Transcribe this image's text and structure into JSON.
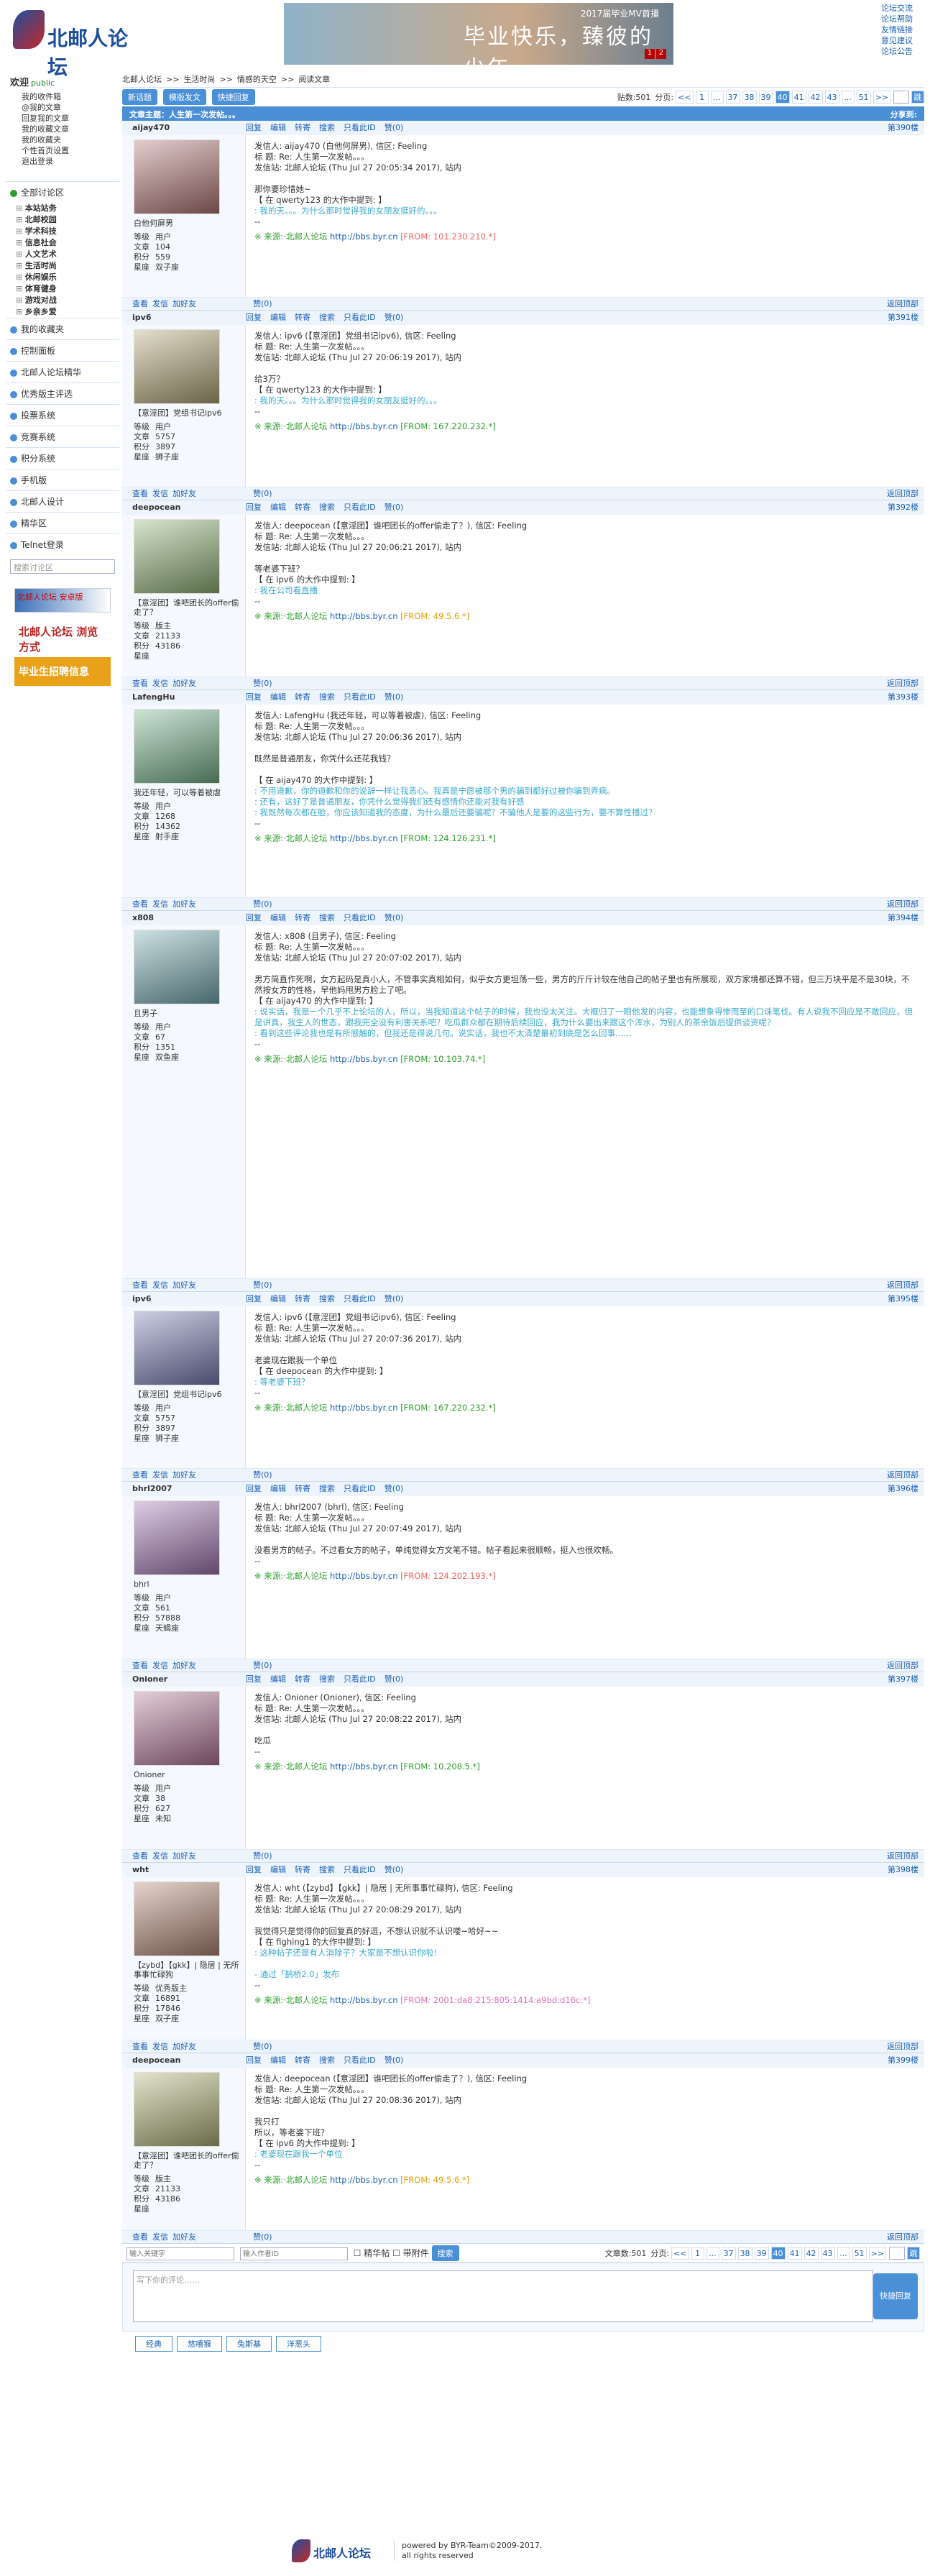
{
  "site": {
    "logo": "北邮人论坛",
    "banner_title": "毕业快乐，臻彼的少年",
    "banner_sub": "2017届毕业MV首播",
    "banner_pages": [
      "1",
      "2"
    ]
  },
  "toplinks": [
    "论坛交流",
    "论坛帮助",
    "友情链接",
    "意见建议",
    "论坛公告"
  ],
  "sidebar": {
    "welcome": "欢迎",
    "user": "public",
    "user_items": [
      "我的收件箱",
      "@我的文章",
      "回复我的文章",
      "我的收藏文章",
      "我的收藏夹",
      "个性首页设置",
      "退出登录"
    ],
    "sections": [
      "全部讨论区",
      "北邮人论坛精华",
      "优秀版主评选",
      "投票系统",
      "竞赛系统",
      "积分系统",
      "手机版",
      "北邮人设计",
      "精华区",
      "Telnet登录"
    ],
    "categories": [
      "本站站务",
      "北邮校园",
      "学术科技",
      "信息社会",
      "人文艺术",
      "生活时尚",
      "休闲娱乐",
      "体育健身",
      "游戏对战",
      "乡亲乡爱"
    ],
    "extra": [
      "我的收藏夹",
      "控制面板"
    ],
    "search_placeholder": "搜索讨论区",
    "ad1": "北邮人论坛 安卓版",
    "ad2": "北邮人论坛 浏览方式",
    "ad3": "毕业生招聘信息"
  },
  "crumb": [
    "北邮人论坛",
    ">>",
    "生活时尚",
    ">>",
    "情感的天空",
    ">>",
    "阅读文章"
  ],
  "toolbar": {
    "new": "新话题",
    "mode": "模版发文",
    "quick": "快捷回复",
    "count_label": "贴数:501",
    "page_label": "分页:"
  },
  "pager": [
    "<<",
    "1",
    "...",
    "37",
    "38",
    "39",
    "40",
    "41",
    "42",
    "43",
    "...",
    "51",
    ">>"
  ],
  "pager_current": "40",
  "thread_title": "文章主题：人生第一次发帖。。。",
  "share": "分享到:",
  "actions": [
    "回复",
    "编辑",
    "转寄",
    "搜索",
    "只看此ID",
    "赞(0)"
  ],
  "foot_actions": [
    "查看",
    "发信",
    "加好友"
  ],
  "back_top": "返回顶部",
  "label_level": "等级",
  "label_posts": "文章",
  "label_score": "积分",
  "label_star": "星座",
  "posts": [
    {
      "user": "aijay470",
      "floor": "第390楼",
      "nick": "白他何屏男",
      "level": "用户",
      "posts": "104",
      "score": "559",
      "star": "双子座",
      "lines": [
        "发信人: aijay470 (白他何屏男), 信区: Feeling",
        "标 题: Re: 人生第一次发帖。。。",
        "发信站: 北邮人论坛 (Thu Jul 27 20:05:34 2017), 站内",
        "",
        "那你要珍惜她~",
        "【 在 qwerty123 的大作中提到: 】"
      ],
      "quotes": [
        ": 我的天。。。为什么那时觉得我的女朋友挺好的。。。"
      ],
      "ip": "[FROM: 101.230.210.*]",
      "ipc": "#f06060"
    },
    {
      "user": "ipv6",
      "floor": "第391楼",
      "nick": "【意淫团】党组书记ipv6",
      "level": "用户",
      "posts": "5757",
      "score": "3897",
      "star": "狮子座",
      "lines": [
        "发信人: ipv6 (【意淫团】党组书记ipv6), 信区: Feeling",
        "标 题: Re: 人生第一次发帖。。。",
        "发信站: 北邮人论坛 (Thu Jul 27 20:06:19 2017), 站内",
        "",
        "给3万？",
        "【 在 qwerty123 的大作中提到: 】"
      ],
      "quotes": [
        ": 我的天。。。为什么那时觉得我的女朋友挺好的。。。"
      ],
      "ip": "[FROM: 167.220.232.*]",
      "ipc": "#2e9e2e"
    },
    {
      "user": "deepocean",
      "floor": "第392楼",
      "nick": "【意淫团】谁吧团长的offer偷走了？",
      "level": "版主",
      "posts": "21133",
      "score": "43186",
      "star": "",
      "lines": [
        "发信人: deepocean (【意淫团】谁吧团长的offer偷走了？), 信区: Feeling",
        "标 题: Re: 人生第一次发帖。。。",
        "发信站: 北邮人论坛 (Thu Jul 27 20:06:21 2017), 站内",
        "",
        "等老婆下班？",
        "【 在 ipv6 的大作中提到: 】"
      ],
      "quotes": [
        ": 我在公司看直播"
      ],
      "ip": "[FROM: 49.5.6.*]",
      "ipc": "#e0a000"
    },
    {
      "user": "LafengHu",
      "floor": "第393楼",
      "nick": "我还年轻，可以等着被虐",
      "level": "用户",
      "posts": "1268",
      "score": "14362",
      "star": "射手座",
      "lines": [
        "发信人: LafengHu (我还年轻，可以等着被虐), 信区: Feeling",
        "标 题: Re: 人生第一次发帖。。。",
        "发信站: 北邮人论坛 (Thu Jul 27 20:06:36 2017), 站内",
        "",
        "既然是普通朋友，你凭什么还花我钱？",
        "",
        "【 在 aijay470 的大作中提到: 】"
      ],
      "quotes": [
        ": 不用道歉，你的道歉和你的说辞一样让我恶心。我真是宁愿被那个男的骗到都好过被你骗到弄病。",
        ": 还有，这好了是普通朋友，你凭什么觉得我们还有感情你还能对我有好感",
        ": 我既然每次都在脸，你应该知道我的态度，为什么最后还要骗呢？不骗他人是要的这些行为，要不算性播过？"
      ],
      "ip": "[FROM: 124.126.231.*]",
      "ipc": "#2e9e2e"
    },
    {
      "user": "x808",
      "floor": "第394楼",
      "nick": "且男子",
      "level": "用户",
      "posts": "67",
      "score": "1351",
      "star": "双鱼座",
      "lines": [
        "发信人: x808 (且男子), 信区: Feeling",
        "标 题: Re: 人生第一次发帖。。。",
        "发信站: 北邮人论坛 (Thu Jul 27 20:07:02 2017), 站内",
        "",
        "男方简直作死啊，女方起码是真小人，不管事实真相如何，似乎女方更坦荡一些，男方的斤斤计较在他自己的帖子里也有所展现，双方家境都还算不错，但三万块平是不是30块，不然按女方的性格，早他妈甩男方脸上了吧。",
        "【 在 aijay470 的大作中提到: 】"
      ],
      "quotes": [
        ": 说实话，我是一个几乎不上论坛的人，所以，当我知道这个帖子的时候，我也没太关注。大概归了一眼他发的内容，也能想象得惨而至的口诛笔伐。有人说我不回应是不敢回应，但是讲真，我生人的世态，跟我完全没有利害关系吧？吃瓜群众都在期待后续回应，我为什么要出来跟这个浑水，为别人的茶余饭后提供谈资呢？",
        ": 看到这些评论我也是有所感触的，但我还是得说几句。说实话，我也不太清楚最初到底是怎么回事……"
      ],
      "ip": "[FROM: 10.103.74.*]",
      "ipc": "#2e9e2e"
    },
    {
      "user": "ipv6",
      "floor": "第395楼",
      "nick": "【意淫团】党组书记ipv6",
      "level": "用户",
      "posts": "5757",
      "score": "3897",
      "star": "狮子座",
      "lines": [
        "发信人: ipv6 (【意淫团】党组书记ipv6), 信区: Feeling",
        "标 题: Re: 人生第一次发帖。。。",
        "发信站: 北邮人论坛 (Thu Jul 27 20:07:36 2017), 站内",
        "",
        "老婆现在跟我一个单位",
        "【 在 deepocean 的大作中提到: 】"
      ],
      "quotes": [
        ": 等老婆下班？"
      ],
      "ip": "[FROM: 167.220.232.*]",
      "ipc": "#2e9e2e"
    },
    {
      "user": "bhrl2007",
      "floor": "第396楼",
      "nick": "bhrl",
      "level": "用户",
      "posts": "561",
      "score": "57888",
      "star": "天蝎座",
      "lines": [
        "发信人: bhrl2007 (bhrl), 信区: Feeling",
        "标 题: Re: 人生第一次发帖。。。",
        "发信站: 北邮人论坛 (Thu Jul 27 20:07:49 2017), 站内",
        "",
        "没看男方的帖子。不过看女方的帖子，单纯觉得女方文笔不错。帖子看起来很顺畅，挺入也很欢畅。"
      ],
      "quotes": [],
      "ip": "[FROM: 124.202.193.*]",
      "ipc": "#f06060"
    },
    {
      "user": "Onioner",
      "floor": "第397楼",
      "nick": "Onioner",
      "level": "用户",
      "posts": "38",
      "score": "627",
      "star": "未知",
      "lines": [
        "发信人: Onioner (Onioner), 信区: Feeling",
        "标 题: Re: 人生第一次发帖。。。",
        "发信站: 北邮人论坛 (Thu Jul 27 20:08:22 2017), 站内",
        "",
        "吃瓜"
      ],
      "quotes": [],
      "ip": "[FROM: 10.208.5.*]",
      "ipc": "#2e9e2e"
    },
    {
      "user": "wht",
      "floor": "第398楼",
      "nick": "【zybd】【gkk】| 隐居 | 无所事事忙碌狗",
      "level": "优秀版主",
      "posts": "16891",
      "score": "17846",
      "star": "双子座",
      "lines": [
        "发信人: wht (【zybd】【gkk】| 隐居 | 无所事事忙碌狗), 信区: Feeling",
        "标 题: Re: 人生第一次发帖。。。",
        "发信站: 北邮人论坛 (Thu Jul 27 20:08:29 2017), 站内",
        "",
        "我觉得只是觉得你的回复真的好逗，不想认识就不认识喽~哈好~~",
        "【 在 fighing1 的大作中提到: 】"
      ],
      "quotes": [
        ": 这种帖子还是有人消除子？大家是不想认识你啦！",
        "",
        "- 通过「鹊桥2.0」发布"
      ],
      "ip": "[FROM: 2001:da8:215:805:1414:a9bd:d16c:*]",
      "ipc": "#e070c0"
    },
    {
      "user": "deepocean",
      "floor": "第399楼",
      "nick": "【意淫团】谁吧团长的offer偷走了？",
      "level": "版主",
      "posts": "21133",
      "score": "43186",
      "star": "",
      "lines": [
        "发信人: deepocean (【意淫团】谁吧团长的offer偷走了？), 信区: Feeling",
        "标 题: Re: 人生第一次发帖。。。",
        "发信站: 北邮人论坛 (Thu Jul 27 20:08:36 2017), 站内",
        "",
        "我只打",
        "所以，等老婆下班？",
        "【 在 ipv6 的大作中提到: 】"
      ],
      "quotes": [
        ": 老婆现在跟我一个单位"
      ],
      "ip": "[FROM: 49.5.6.*]",
      "ipc": "#e0a000"
    }
  ],
  "source_label": "※ 来源:·北邮人论坛",
  "source_url": "http://bbs.byr.cn",
  "bottom": {
    "kw": "输入关键字",
    "id": "输入作者ID",
    "att1": "精华帖",
    "att2": "带附件",
    "search": "搜索",
    "count": "文章数:501",
    "page": "分页:"
  },
  "reply": {
    "placeholder": "写下你的评论……",
    "submit": "快捷回复",
    "tabs": [
      "经典",
      "悠嘻猴",
      "兔斯基",
      "洋葱头"
    ]
  },
  "footer": {
    "logo": "北邮人论坛",
    "line1": "powered by BYR-Team©2009-2017.",
    "line2": "all rights reserved"
  }
}
